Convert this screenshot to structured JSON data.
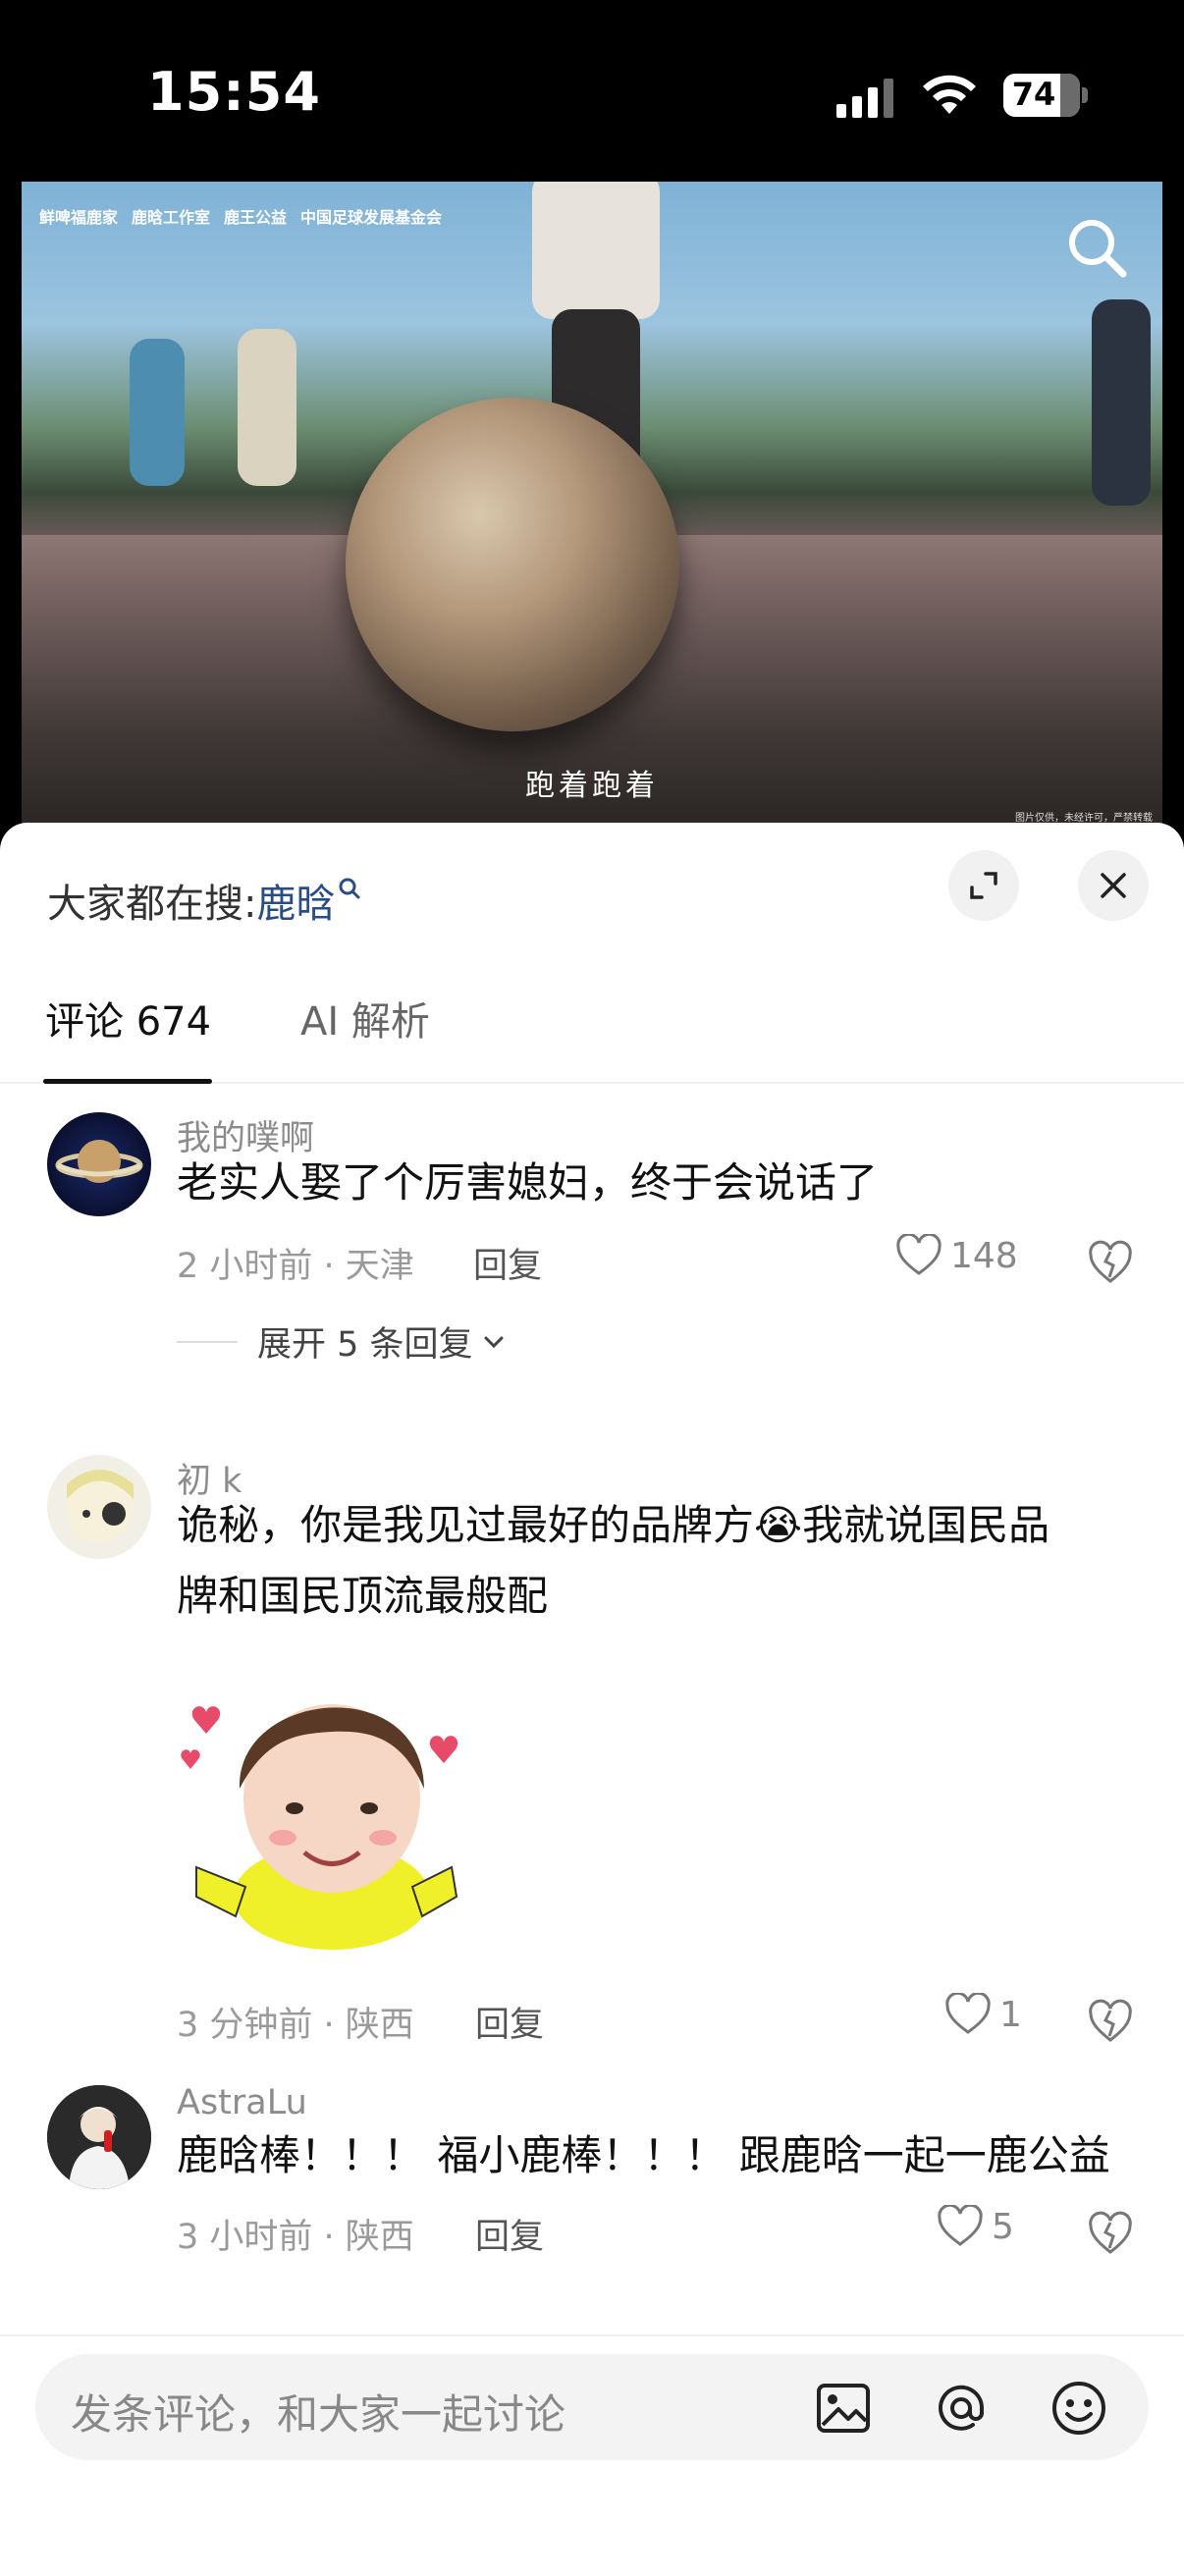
{
  "status_bar": {
    "time": "15:54",
    "battery": "74"
  },
  "video": {
    "logos": [
      "鲜啤福鹿家",
      "鹿晗工作室",
      "鹿王公益",
      "中国足球发展基金会"
    ],
    "caption": "跑着跑着",
    "credits": "图片仅供，未经许可，严禁转载"
  },
  "sheet": {
    "hot_search_label": "大家都在搜:",
    "hot_search_keyword": "鹿晗",
    "tabs": [
      {
        "label": "评论 674",
        "active": true
      },
      {
        "label": "AI 解析",
        "active": false
      }
    ]
  },
  "comments": [
    {
      "username": "我的噗啊",
      "text": "老实人娶了个厉害媳妇，终于会说话了",
      "meta": "2 小时前 · 天津",
      "reply_label": "回复",
      "likes": "148",
      "expand_label": "展开 5 条回复"
    },
    {
      "username": "初 k",
      "text_part1": "诡秘，你是我见过最好的品牌方",
      "emoji": "😭",
      "text_part2": "我就说国民品",
      "text_line2": "牌和国民顶流最般配",
      "meta": "3 分钟前 · 陕西",
      "reply_label": "回复",
      "likes": "1"
    },
    {
      "username": "AstraLu",
      "text": "鹿晗棒！！！ 福小鹿棒！！！ 跟鹿晗一起一鹿公益",
      "meta": "3 小时前 · 陕西",
      "reply_label": "回复",
      "likes": "5"
    }
  ],
  "input": {
    "placeholder": "发条评论，和大家一起讨论"
  },
  "colors": {
    "keyword": "#2a4d86",
    "text": "#111111",
    "muted": "#9a9a9a"
  }
}
